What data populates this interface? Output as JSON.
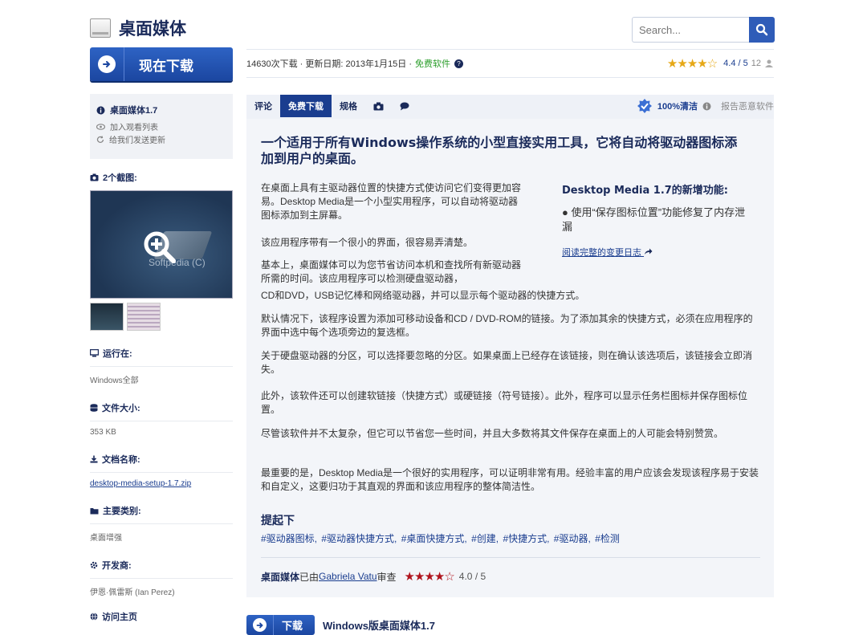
{
  "header": {
    "title": "桌面媒体",
    "search_placeholder": "Search..."
  },
  "download_button": {
    "label": "现在下载"
  },
  "infobar": {
    "downloads": "14630次下载 · 更新日期: 2013年1月15日 · ",
    "license": "免费软件",
    "rating_score": "4.4 / 5",
    "rating_count": "12",
    "stars": "★★★★☆"
  },
  "sidebar": {
    "version": "桌面媒体1.7",
    "watchlist": "加入观看列表",
    "send_update": "给我们发送更新",
    "screenshots_title": "2个截图:",
    "screenshot_watermark": "Softpedia (C)",
    "runs_on_label": "运行在:",
    "runs_on_value": "Windows全部",
    "file_size_label": "文件大小:",
    "file_size_value": "353 KB",
    "file_name_label": "文档名称:",
    "file_name_value": "desktop-media-setup-1.7.zip",
    "category_label": "主要类别:",
    "category_value": "桌面增强",
    "developer_label": "开发商:",
    "developer_value": "伊恩·佩雷斯 (Ian Perez)",
    "homepage_label": "访问主页"
  },
  "tabs": [
    {
      "label": "评论"
    },
    {
      "label": "免费下载"
    },
    {
      "label": "规格"
    }
  ],
  "clean_label": "100%清洁",
  "report_label": "报告恶意软件",
  "article": {
    "headline": "一个适用于所有Windows操作系统的小型直接实用工具，它将自动将驱动器图标添加到用户的桌面。",
    "p1": "在桌面上具有主驱动器位置的快捷方式使访问它们变得更加容易。Desktop Media是一个小型实用程序，可以自动将驱动器图标添加到主屏幕。",
    "p2": "该应用程序带有一个很小的界面，很容易弄清楚。",
    "p3a": "基本上，桌面媒体可以为您节省访问本机和查找所有新驱动器所需的时间。该应用程序可以检测硬盘驱动器，",
    "p3b": "CD和DVD，USB记忆棒和网络驱动器，并可以显示每个驱动器的快捷方式。",
    "p4": "默认情况下，该程序设置为添加可移动设备和CD / DVD-ROM的链接。为了添加其余的快捷方式，必须在应用程序的界面中选中每个选项旁边的复选框。",
    "p5": "关于硬盘驱动器的分区，可以选择要忽略的分区。如果桌面上已经存在该链接，则在确认该选项后，该链接会立即消失。",
    "p6": "此外，该软件还可以创建软链接（快捷方式）或硬链接（符号链接）。此外，程序可以显示任务栏图标并保存图标位置。",
    "p7": "尽管该软件并不太复杂，但它可以节省您一些时间，并且大多数将其文件保存在桌面上的人可能会特别赞赏。",
    "p8": "最重要的是，Desktop Media是一个很好的实用程序，可以证明非常有用。经验丰富的用户应该会发现该程序易于安装和自定义，这要归功于其直观的界面和该应用程序的整体简洁性。"
  },
  "changelog": {
    "title": "Desktop Media 1.7的新增功能:",
    "item": "使用“保存图标位置”功能修复了内存泄漏",
    "link": "阅读完整的变更日志"
  },
  "tags": {
    "title": "提起下",
    "items": [
      "#驱动器图标,",
      "#驱动器快捷方式,",
      "#桌面快捷方式,",
      "#创建,",
      "#快捷方式,",
      "#驱动器,",
      "#检测"
    ]
  },
  "review": {
    "app": "桌面媒体",
    "by": "已由",
    "author": "Gabriela Vatu",
    "suffix": "审查",
    "stars": "★★★★☆",
    "score": "4.0 / 5"
  },
  "bottom": {
    "button": "下载",
    "text": "Windows版桌面媒体1.7"
  }
}
